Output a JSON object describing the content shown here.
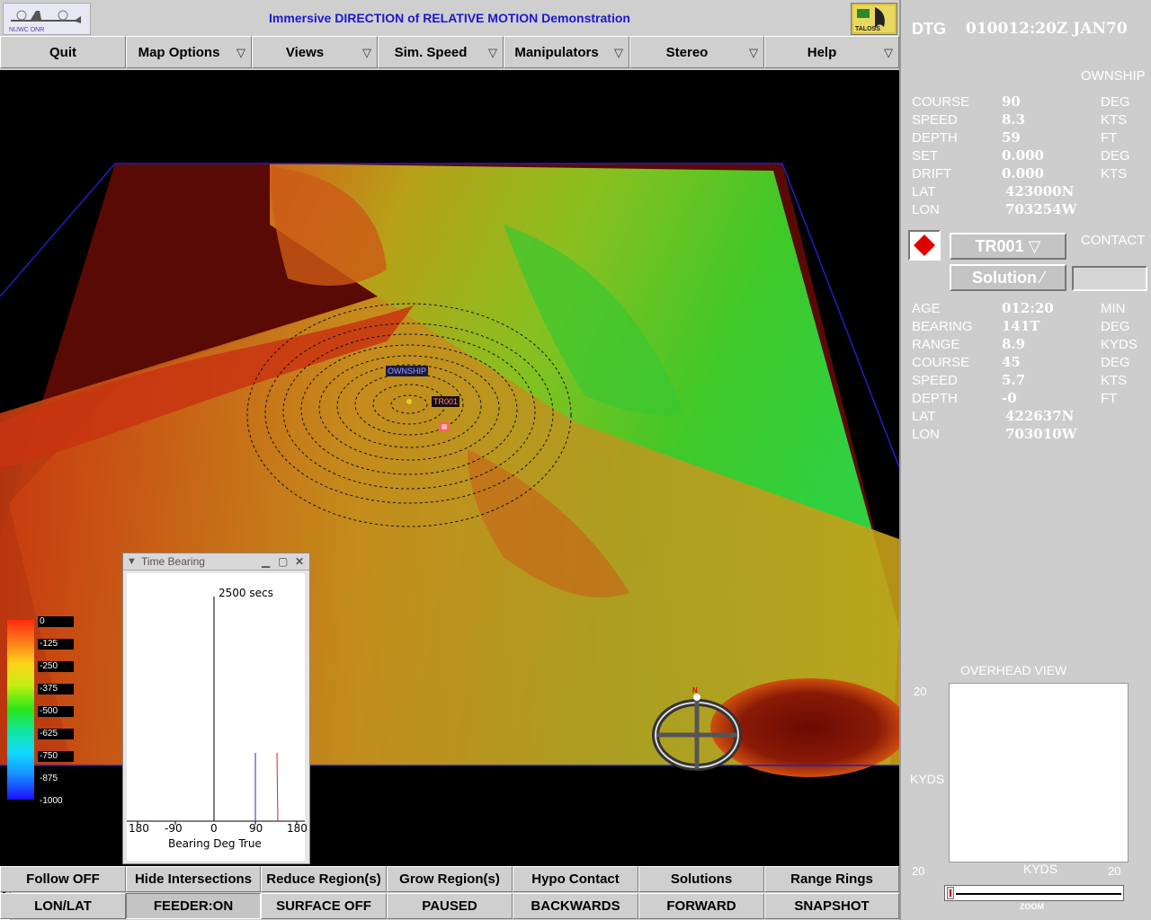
{
  "title": "Immersive DIRECTION of RELATIVE MOTION Demonstration",
  "logos": {
    "left_text": "NUWC ONR",
    "right_text": "TALOSS"
  },
  "menu": [
    {
      "label": "Quit",
      "dropdown": false
    },
    {
      "label": "Map Options",
      "dropdown": true
    },
    {
      "label": "Views",
      "dropdown": true
    },
    {
      "label": "Sim. Speed",
      "dropdown": true
    },
    {
      "label": "Manipulators",
      "dropdown": true
    },
    {
      "label": "Stereo",
      "dropdown": true
    },
    {
      "label": "Help",
      "dropdown": true
    }
  ],
  "scene": {
    "ownship_label": "OWNSHIP",
    "contact_label": "TR001",
    "compass_north": "N",
    "legend": [
      "0",
      "-125",
      "-250",
      "-375",
      "-500",
      "-625",
      "-750",
      "-875",
      "-1000"
    ]
  },
  "time_bearing": {
    "window_title": "Time Bearing",
    "time_label": "2500 secs",
    "x_ticks": [
      "180",
      "-90",
      "0",
      "90",
      "180"
    ],
    "x_label": "Bearing Deg True"
  },
  "buttons_row1": [
    "Follow OFF",
    "Hide Intersections",
    "Reduce Region(s)",
    "Grow Region(s)",
    "Hypo Contact",
    "Solutions",
    "Range Rings"
  ],
  "buttons_row2": [
    "LON/LAT",
    "FEEDER:ON",
    "SURFACE OFF",
    "PAUSED",
    "BACKWARDS",
    "FORWARD",
    "SNAPSHOT"
  ],
  "panel": {
    "dtg_label": "DTG",
    "dtg_value": "010012:20Z JAN70",
    "ownship_header": "OWNSHIP",
    "ownship": [
      {
        "label": "COURSE",
        "value": "90",
        "unit": "DEG"
      },
      {
        "label": "SPEED",
        "value": "8.3",
        "unit": "KTS"
      },
      {
        "label": "DEPTH",
        "value": "59",
        "unit": "FT"
      },
      {
        "label": "SET",
        "value": "0.000",
        "unit": "DEG"
      },
      {
        "label": "DRIFT",
        "value": "0.000",
        "unit": "KTS"
      },
      {
        "label": "LAT",
        "value": "423000N",
        "unit": ""
      },
      {
        "label": "LON",
        "value": "703254W",
        "unit": ""
      }
    ],
    "contact_header": "CONTACT",
    "contact_select": "TR001",
    "solution_select": "Solution",
    "contact": [
      {
        "label": "AGE",
        "value": "012:20",
        "unit": "MIN"
      },
      {
        "label": "BEARING",
        "value": "141T",
        "unit": "DEG"
      },
      {
        "label": "RANGE",
        "value": "8.9",
        "unit": "KYDS"
      },
      {
        "label": "COURSE",
        "value": "45",
        "unit": "DEG"
      },
      {
        "label": "SPEED",
        "value": "5.7",
        "unit": "KTS"
      },
      {
        "label": "DEPTH",
        "value": "-0",
        "unit": "FT"
      },
      {
        "label": "LAT",
        "value": "422637N",
        "unit": ""
      },
      {
        "label": "LON",
        "value": "703010W",
        "unit": ""
      }
    ],
    "overhead_title": "OVERHEAD VIEW",
    "overhead_top_left": "20",
    "overhead_kyds_left": "KYDS",
    "overhead_bottom_left": "20",
    "overhead_kyds_bottom": "KYDS",
    "overhead_bottom_right": "20",
    "zoom_label": "ZOOM"
  },
  "colors": {
    "title": "#1a1acc",
    "contact_marker": "#e00000",
    "terrain_shallow": "#d83010",
    "terrain_deep": "#20c020"
  }
}
